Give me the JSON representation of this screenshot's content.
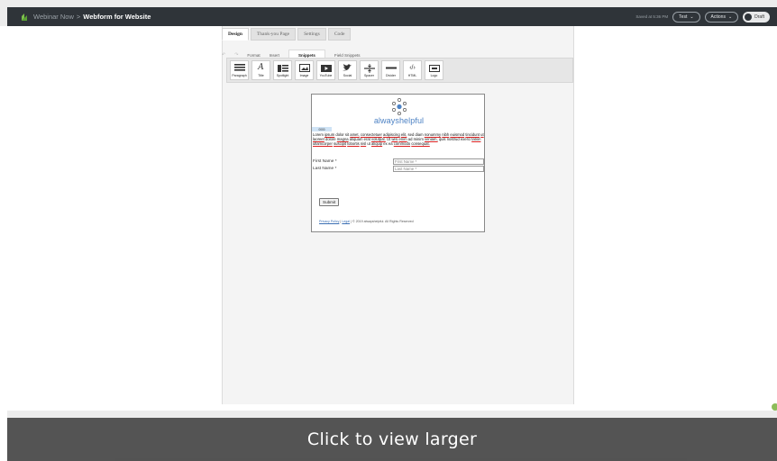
{
  "header": {
    "breadcrumb_parent": "Webinar Now",
    "breadcrumb_separator": ">",
    "breadcrumb_current": "Webform for Website",
    "saved_text": "Saved at 5:36 PM",
    "test_label": "Test",
    "actions_label": "Actions",
    "status_label": "Draft"
  },
  "tabs": [
    "Design",
    "Thank-you Page",
    "Settings",
    "Code"
  ],
  "subtabs": [
    "Format",
    "Insert",
    "Snippets",
    "Field Snippets"
  ],
  "toolbar": {
    "items": [
      "Paragraph",
      "Title",
      "Spotlight",
      "Image",
      "YouTube",
      "Social",
      "Spacer",
      "Divider",
      "HTML",
      "Logo"
    ]
  },
  "form": {
    "brand_name": "alwayshelpful",
    "rich_text_bar": "0000",
    "lorem_words": [
      "Lorem",
      "ipsum",
      "dolor",
      "sit",
      "amet,",
      "consectetuer",
      "adipiscing",
      "elit,",
      "sed",
      "diam",
      "nonummy",
      "nibh",
      "euismod",
      "tincidunt",
      "ut",
      "laoreet",
      "dolore",
      "magna",
      "aliquam",
      "erat",
      "volutpat.",
      "Ut",
      "wisi",
      "enim",
      "ad",
      "minim",
      "veniam,",
      "quis",
      "nostrud",
      "exerci",
      "tation",
      "ullamcorper",
      "suscipit",
      "lobortis",
      "nisl",
      "ut",
      "aliquip",
      "ex",
      "ea",
      "commodo",
      "consequat."
    ],
    "first_name_label": "First Name *",
    "first_name_placeholder": "First Name *",
    "last_name_label": "Last Name *",
    "last_name_placeholder": "Last Name *",
    "submit_label": "Submit",
    "footer_privacy": "Privacy Policy",
    "footer_sep": "|",
    "footer_legal": "Legal",
    "footer_copyright": "| © 2019 alwayshelpful. All Rights Reserved"
  },
  "overlay": {
    "label": "Click to view larger"
  },
  "colors": {
    "topbar": "#2f3439",
    "brand": "#4d82c4",
    "overlay": "#4e4e4e"
  }
}
